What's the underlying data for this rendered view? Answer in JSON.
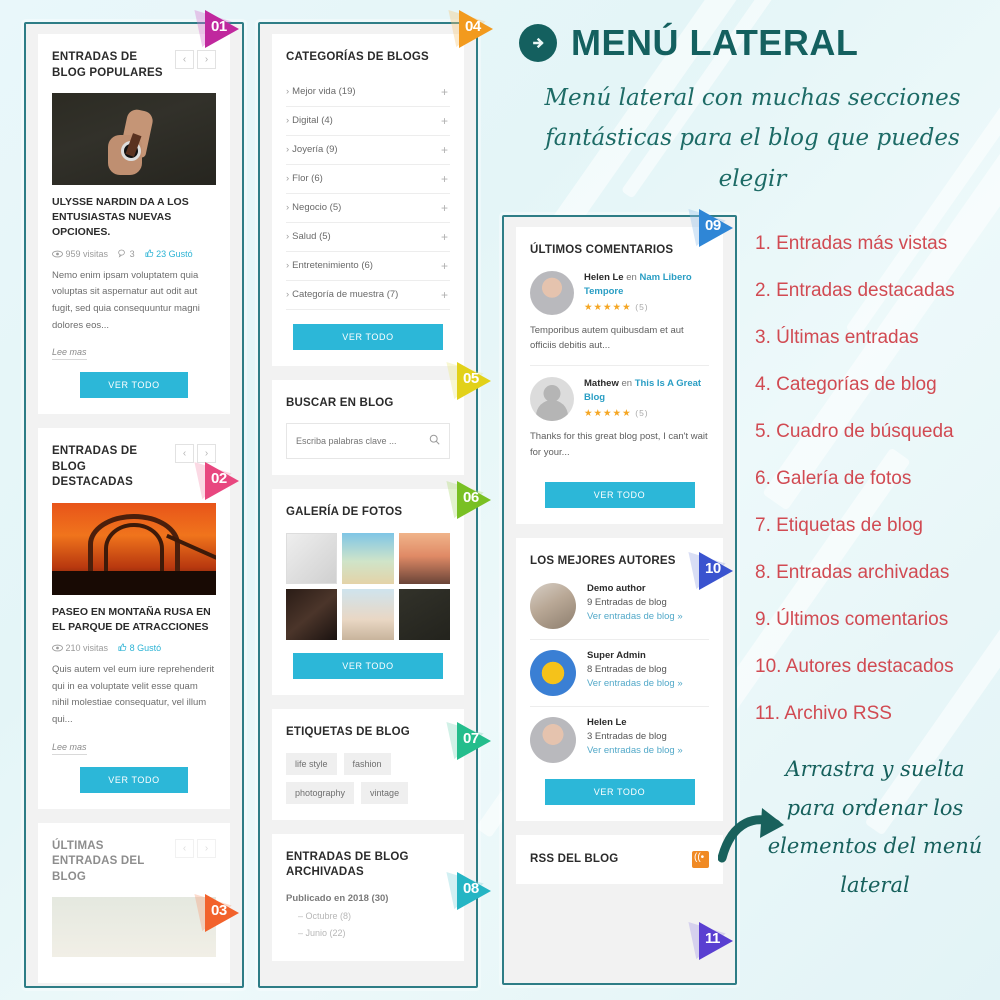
{
  "right_panel": {
    "title": "MENÚ LATERAL",
    "title_icon": "arrow-right-circle-icon",
    "subtitle": "Menú lateral con muchas secciones fantásticas para el blog que puedes elegir",
    "feature_list": [
      "1. Entradas más vistas",
      "2. Entradas destacadas",
      "3. Últimas entradas",
      "4. Categorías de blog",
      "5. Cuadro de búsqueda",
      "6. Galería de fotos",
      "7. Etiquetas de blog",
      "8. Entradas archivadas",
      "9. Últimos comentarios",
      "10. Autores destacados",
      "11. Archivo RSS"
    ],
    "drag_note": "Arrastra y suelta para ordenar los elementos del menú lateral",
    "colors": {
      "teal": "#14605f",
      "red": "#d14a52",
      "accent": "#2cb7d8"
    }
  },
  "badges": [
    {
      "num": "01",
      "color": "#c0289e",
      "color2": "#d87ad0"
    },
    {
      "num": "02",
      "color": "#e8477f",
      "color2": "#f59bb8"
    },
    {
      "num": "03",
      "color": "#f2622c",
      "color2": "#f7a07b"
    },
    {
      "num": "04",
      "color": "#f29a1e",
      "color2": "#f7c87a"
    },
    {
      "num": "05",
      "color": "#e2d119",
      "color2": "#ece98a"
    },
    {
      "num": "06",
      "color": "#79c023",
      "color2": "#b2dc7c"
    },
    {
      "num": "07",
      "color": "#24bd8c",
      "color2": "#86d9bf"
    },
    {
      "num": "08",
      "color": "#25b5c4",
      "color2": "#8ad8e0"
    },
    {
      "num": "09",
      "color": "#2f86d6",
      "color2": "#92bfe9"
    },
    {
      "num": "10",
      "color": "#3a53cf",
      "color2": "#9aa7e6"
    },
    {
      "num": "11",
      "color": "#5a3fd1",
      "color2": "#a79ae8"
    }
  ],
  "common": {
    "see_all": "Ver todo",
    "read_more": "Lee mas",
    "prev": "‹",
    "next": "›"
  },
  "cards": {
    "popular": {
      "title": "Entradas de blog populares",
      "post_title": "Ulysse Nardin da a los entusiastas nuevas opciones.",
      "views": "959 visitas",
      "comments": "3",
      "likes": "23 Gustó",
      "excerpt": "Nemo enim ipsam voluptatem quia voluptas sit aspernatur aut odit aut fugit, sed quia consequuntur magni dolores eos..."
    },
    "featured": {
      "title": "Entradas de blog destacadas",
      "post_title": "Paseo en montaña rusa en el parque de atracciones",
      "views": "210 visitas",
      "likes": "8 Gustó",
      "excerpt": "Quis autem vel eum iure reprehenderit qui in ea voluptate velit esse quam nihil molestiae consequatur, vel illum qui..."
    },
    "latest": {
      "title": "Últimas entradas del blog"
    },
    "categories": {
      "title": "Categorías de blogs",
      "items": [
        "Mejor vida (19)",
        "Digital (4)",
        "Joyería (9)",
        "Flor (6)",
        "Negocio (5)",
        "Salud (5)",
        "Entretenimiento (6)",
        "Categoría de muestra (7)"
      ]
    },
    "search": {
      "title": "Buscar en blog",
      "placeholder": "Escriba palabras clave ...",
      "value": "",
      "icon": "search-icon"
    },
    "gallery": {
      "title": "Galería de fotos",
      "count": 6
    },
    "tags": {
      "title": "Etiquetas de blog",
      "items": [
        "life style",
        "fashion",
        "photography",
        "vintage"
      ]
    },
    "archived": {
      "title": "Entradas de blog archivadas",
      "group": "Publicado en 2018 (30)",
      "items": [
        "– Octubre (8)",
        "– Junio (22)"
      ]
    },
    "comments": {
      "title": "Últimos comentarios",
      "items": [
        {
          "author": "Helen Le",
          "on": "en",
          "post": "Nam Libero Tempore",
          "rating": "★★★★★",
          "rating_count": "(5)",
          "text": "Temporibus autem quibusdam et aut officiis debitis aut..."
        },
        {
          "author": "Mathew",
          "on": "en",
          "post": "This Is A Great Blog",
          "rating": "★★★★★",
          "rating_count": "(5)",
          "text": "Thanks for this great blog post, I can't wait for your..."
        }
      ]
    },
    "authors": {
      "title": "Los mejores autores",
      "items": [
        {
          "name": "Demo author",
          "count": "9 Entradas de blog",
          "link": "Ver entradas de blog »"
        },
        {
          "name": "Super Admin",
          "count": "8 Entradas de blog",
          "link": "Ver entradas de blog »"
        },
        {
          "name": "Helen Le",
          "count": "3 Entradas de blog",
          "link": "Ver entradas de blog »"
        }
      ]
    },
    "rss": {
      "title": "RSS del blog",
      "icon": "rss-icon"
    }
  }
}
